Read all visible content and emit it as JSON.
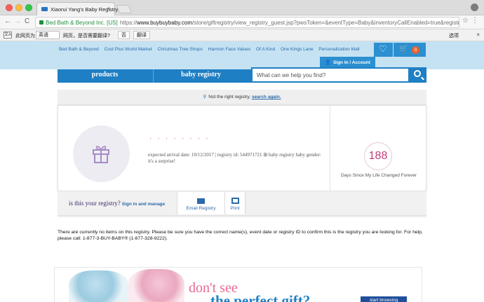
{
  "browser": {
    "tab_title": "Xiaorui Yang's Baby Registry",
    "tab_close": "×",
    "org": "Bed Bath & Beyond Inc. [US]",
    "url_prefix": "https://",
    "url_domain": "www.buybuybaby.com",
    "url_path": "/store/giftregistry/view_registry_guest.jsp?pwsToken=&eventType=Baby&inventoryCallEnabled=true&registr...",
    "back": "←",
    "forward": "→",
    "reload": "C",
    "star": "☆",
    "menu": "⋮"
  },
  "translate_bar": {
    "icon_text": "文A",
    "label": "此网页为",
    "language": "英语",
    "question": "网页，是否需要翻译?",
    "no_button": "否",
    "translate_button": "翻译",
    "options": "选项",
    "close": "×"
  },
  "site": {
    "sister_links": [
      "Bed Bath & Beyond",
      "Cost Plus World Market",
      "Christmas Tree Shops",
      "Harmon Face Values",
      "Of A Kind",
      "One Kings Lane",
      "Personalization Mall"
    ],
    "cart_count": "0",
    "sign_in": "Sign In / Account",
    "nav_products": "products",
    "nav_baby_registry": "baby registry",
    "search_placeholder": "What can we help you find?",
    "not_right": "Not the right registry,",
    "search_again": "search again."
  },
  "registry": {
    "name_redacted": "· · · · · · · ·",
    "meta_line1": "expected arrival date: 10/12/2017   |   registry id: 544971721",
    "meta_type": "baby registry",
    "meta_line2": "baby gender: it's a surprise!",
    "countdown_value": "188",
    "countdown_label": "Days Since My Life Changed Forever"
  },
  "actions": {
    "is_this_your": "is this your registry?",
    "sign_in_manage": "Sign in and manage",
    "email_registry": "Email Registry",
    "print": "Print"
  },
  "notice": "There are currently no items on this registry. Please be sure you have the correct name(s), event date or registry ID to confirm this is the registry you are looking for. For help, please call: 1-877-3-BUY-BABY® (1-877-328-9222).",
  "promo": {
    "line1": "don't see",
    "line2": "the perfect gift?",
    "button": "start browsing"
  },
  "colors": {
    "brand_blue": "#1f7fc4",
    "header_light_blue": "#c5e2f3",
    "countdown_pink": "#c23d7a",
    "cart_badge_orange": "#e8632c"
  }
}
